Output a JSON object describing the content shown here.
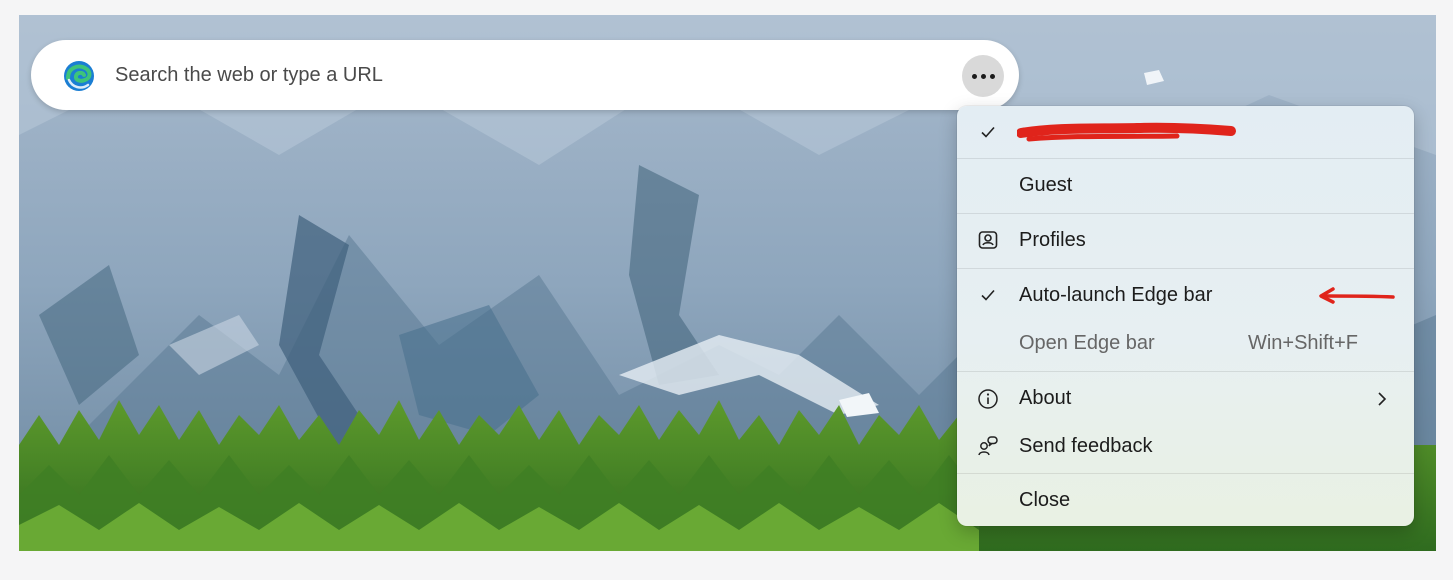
{
  "search": {
    "placeholder": "Search the web or type a URL",
    "value": ""
  },
  "icons": {
    "edge_logo": "edge-logo-icon",
    "more": "more-horizontal-icon",
    "check": "checkmark-icon",
    "profiles": "profiles-icon",
    "info": "info-icon",
    "feedback": "feedback-icon",
    "chevron": "chevron-right-icon"
  },
  "menu": {
    "items": [
      {
        "label": "",
        "checked": true,
        "redacted": true
      },
      {
        "label": "Guest",
        "checked": false
      },
      {
        "label": "Profiles",
        "icon": "profiles-icon"
      },
      {
        "label": "Auto-launch Edge bar",
        "checked": true
      },
      {
        "label": "Open Edge bar",
        "shortcut": "Win+Shift+F",
        "disabled": true
      },
      {
        "label": "About",
        "icon": "info-icon",
        "submenu": true
      },
      {
        "label": "Send feedback",
        "icon": "feedback-icon"
      },
      {
        "label": "Close"
      }
    ]
  },
  "colors": {
    "annotation_red": "#e0241b",
    "menu_bg": "#e6eef2",
    "edge_blue": "#1b7ed3",
    "edge_green": "#3ec47a"
  }
}
